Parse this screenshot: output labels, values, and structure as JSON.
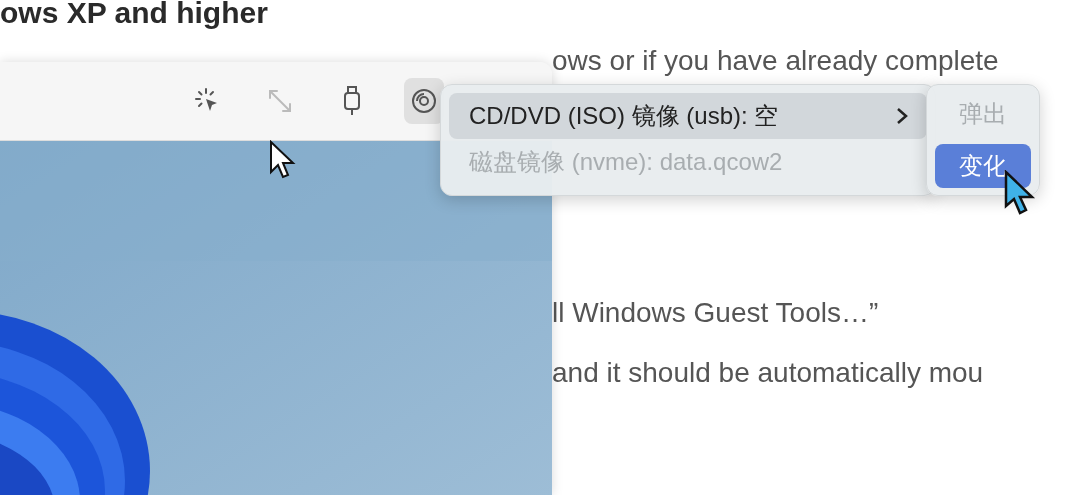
{
  "page": {
    "heading": "ows XP and higher",
    "lines": [
      "ows or if you have already complete",
      "ll Windows Guest Tools…”",
      "and it should be automatically mou"
    ]
  },
  "vm_window": {
    "toolbar": [
      {
        "kind": "capture",
        "selected": false,
        "disabled": false
      },
      {
        "kind": "resize",
        "selected": false,
        "disabled": true
      },
      {
        "kind": "usb",
        "selected": false,
        "disabled": false
      },
      {
        "kind": "drive",
        "selected": true,
        "disabled": false
      }
    ]
  },
  "drive_menu": {
    "items": [
      {
        "label": "CD/DVD (ISO) 镜像 (usb): 空",
        "selected": true,
        "disabled": false,
        "has_submenu": true
      },
      {
        "label": "磁盘镜像 (nvme): data.qcow2",
        "selected": false,
        "disabled": true,
        "has_submenu": false
      }
    ]
  },
  "submenu": {
    "items": [
      {
        "label": "弹出",
        "selected": false,
        "disabled": true
      },
      {
        "label": "变化",
        "selected": true,
        "disabled": false
      }
    ]
  }
}
